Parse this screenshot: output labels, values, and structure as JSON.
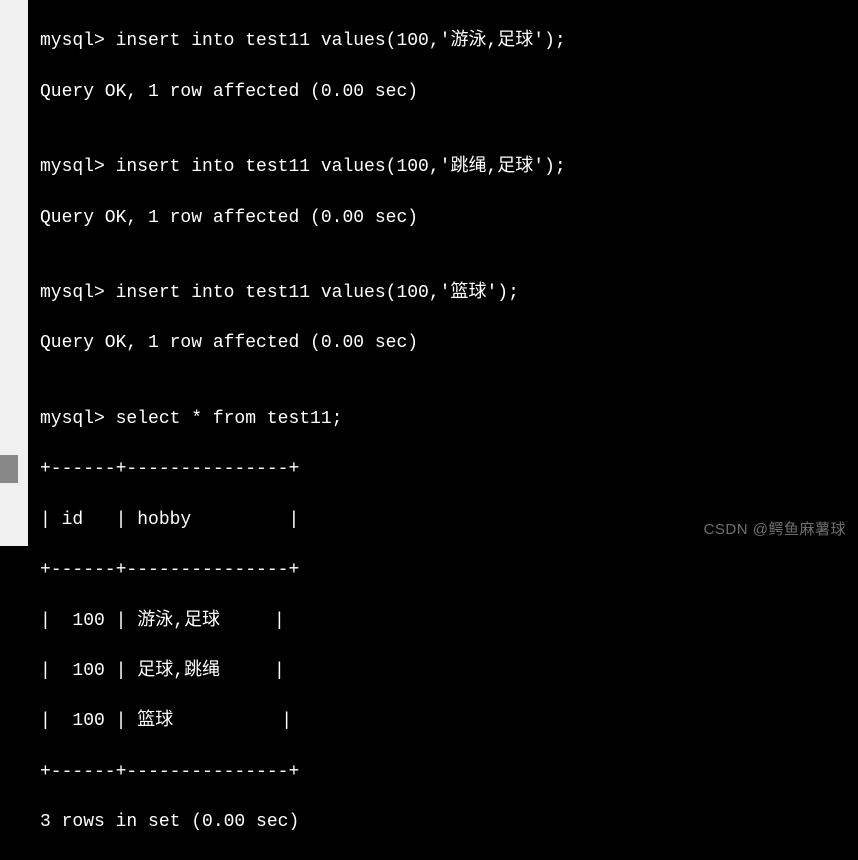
{
  "terminal": {
    "prompt": "mysql>",
    "lines": [
      "mysql> insert into test11 values(100,'游泳,足球');",
      "Query OK, 1 row affected (0.00 sec)",
      "",
      "mysql> insert into test11 values(100,'跳绳,足球');",
      "Query OK, 1 row affected (0.00 sec)",
      "",
      "mysql> insert into test11 values(100,'篮球');",
      "Query OK, 1 row affected (0.00 sec)",
      "",
      "mysql> select * from test11;",
      "+------+---------------+",
      "| id   | hobby         |",
      "+------+---------------+",
      "|  100 | 游泳,足球     |",
      "|  100 | 足球,跳绳     |",
      "|  100 | 篮球          |",
      "+------+---------------+",
      "3 rows in set (0.00 sec)"
    ],
    "statements": [
      {
        "sql": "insert into test11 values(100,'游泳,足球');",
        "result": "Query OK, 1 row affected (0.00 sec)"
      },
      {
        "sql": "insert into test11 values(100,'跳绳,足球');",
        "result": "Query OK, 1 row affected (0.00 sec)"
      },
      {
        "sql": "insert into test11 values(100,'篮球');",
        "result": "Query OK, 1 row affected (0.00 sec)"
      },
      {
        "sql": "select * from test11;",
        "result": "3 rows in set (0.00 sec)"
      }
    ],
    "table": {
      "columns": [
        "id",
        "hobby"
      ],
      "rows": [
        {
          "id": 100,
          "hobby": "游泳,足球"
        },
        {
          "id": 100,
          "hobby": "足球,跳绳"
        },
        {
          "id": 100,
          "hobby": "篮球"
        }
      ]
    }
  },
  "watermark": "CSDN @鳄鱼麻薯球"
}
